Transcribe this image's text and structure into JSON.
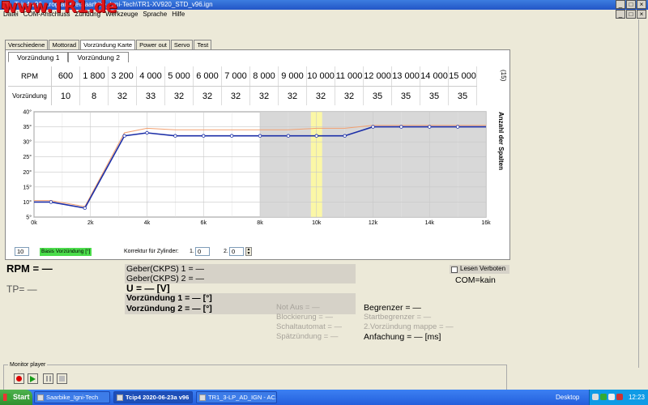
{
  "titlebar": {
    "title": "Tcip4 v96 ...rogramme\\Saarbike_Igni-Tech\\TR1-XV920_STD_v96.ign",
    "watermark": "www.TR1.de"
  },
  "menu": [
    "Datei",
    "COM-Anschluss",
    "Zündung",
    "Werkzeuge",
    "Sprache",
    "Hilfe"
  ],
  "tabs": [
    "Verschiedene",
    "Mottorad",
    "Vorzündung Karte",
    "Power out",
    "Servo",
    "Test"
  ],
  "active_tab": "Vorzündung Karte",
  "subtabs": [
    "Vorzündung 1",
    "Vorzündung 2"
  ],
  "table": {
    "rpm_label": "RPM",
    "adv_label": "Vorzündung",
    "rpm": [
      "600",
      "1 800",
      "3 200",
      "4 000",
      "5 000",
      "6 000",
      "7 000",
      "8 000",
      "9 000",
      "10 000",
      "11 000",
      "12 000",
      "13 000",
      "14 000",
      "15 000"
    ],
    "advance": [
      "10",
      "8",
      "32",
      "33",
      "32",
      "32",
      "32",
      "32",
      "32",
      "32",
      "32",
      "35",
      "35",
      "35",
      "35"
    ],
    "count": "(15)"
  },
  "side_label": "Anzahl der Spalten",
  "chart_data": {
    "type": "line",
    "x_ticks": [
      "0k",
      "2k",
      "4k",
      "6k",
      "8k",
      "10k",
      "12k",
      "14k",
      "16k"
    ],
    "y_ticks": [
      "5°",
      "10°",
      "15°",
      "20°",
      "25°",
      "30°",
      "35°",
      "40°"
    ],
    "xlim": [
      0,
      16000
    ],
    "ylim": [
      5,
      40
    ],
    "grid": true,
    "gray_region": [
      8000,
      16000
    ],
    "highlight_band": [
      9800,
      10200
    ],
    "series": [
      {
        "color": "#1c2fa8",
        "x": [
          0,
          600,
          1800,
          3200,
          4000,
          5000,
          6000,
          7000,
          8000,
          9000,
          10000,
          11000,
          12000,
          13000,
          14000,
          15000,
          16000
        ],
        "y": [
          10,
          10,
          8,
          32,
          33,
          32,
          32,
          32,
          32,
          32,
          32,
          32,
          35,
          35,
          35,
          35,
          35
        ]
      },
      {
        "color": "#f2a070",
        "x": [
          0,
          600,
          1800,
          3200,
          4000,
          5000,
          6000,
          7000,
          8000,
          9000,
          10000,
          11000,
          12000,
          13000,
          14000,
          15000,
          16000
        ],
        "y": [
          10.5,
          10.5,
          8.5,
          33,
          34.5,
          34,
          34,
          34,
          34,
          34,
          34.5,
          34.5,
          35.5,
          35.5,
          35.5,
          35.5,
          35.5
        ]
      }
    ]
  },
  "controls": {
    "basis_value": "10",
    "basis_label": "Basis Vorzündung [°]",
    "korrektur_label": "Korrektur für Zylinder:",
    "cyl1_label": "1.",
    "cyl1_value": "0",
    "cyl2_label": "2.",
    "cyl2_value": "0"
  },
  "status": {
    "rpm": "RPM = —",
    "tp": "TP= —",
    "geber1": "Geber(CKPS) 1 = —",
    "geber2": "Geber(CKPS) 2 = —",
    "u": "U = — [V]",
    "vz1": "Vorzündung 1 = — [°]",
    "vz2": "Vorzündung 2 = — [°]",
    "notaus": "Not Aus = —",
    "blockierung": "Blockierung = —",
    "schaltautomat": "Schaltautomat = —",
    "spatzundung": "Spätzündung = —",
    "begrenzer": "Begrenzer = —",
    "startbegrenzer": "Startbegrenzer = —",
    "vz_mappe": "2.Vorzündung mappe = —",
    "anfachung": "Anfachung = — [ms]",
    "lesen_label": "Lesen Verboten",
    "com": "COM=kain"
  },
  "monitor": {
    "label": "Monitor player"
  },
  "taskbar": {
    "start": "Start",
    "tasks": [
      "Saarbike_Igni-Tech",
      "Tcip4 2020-06-23a v96",
      "TR1_3-LP_AD_IGN - AC..."
    ],
    "active_task": "Tcip4 2020-06-23a v96",
    "desktop": "Desktop",
    "clock": "12:23"
  },
  "colors": {
    "title_bar": "#2355c6",
    "taskbar": "#245edc",
    "start": "#2f8f2f",
    "gray_region": "#d8d8d8",
    "highlight": "#fbf7a6",
    "basis_label_bg": "#4bdc4b"
  }
}
